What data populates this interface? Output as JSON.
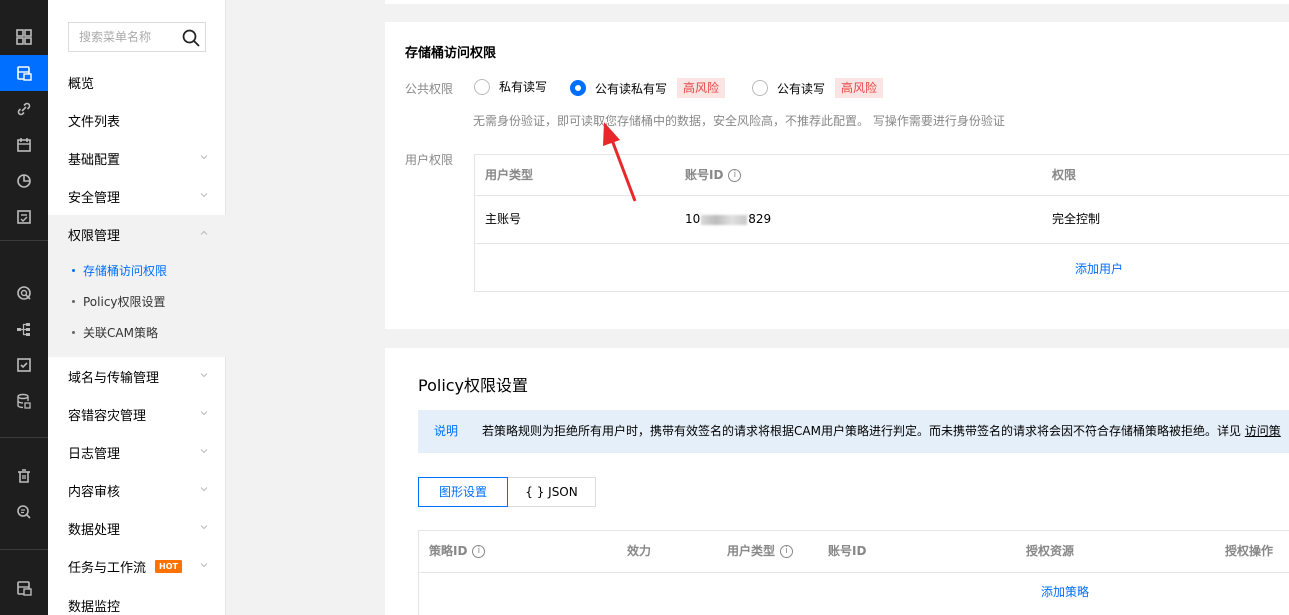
{
  "rail": {
    "icons": [
      "grid-icon",
      "bucket-icon",
      "link-icon",
      "calendar-icon",
      "pie-chart-icon",
      "checklist-icon",
      "monitor-icon",
      "hierarchy-icon",
      "checkbox-icon",
      "database-icon",
      "trash-icon",
      "search-doc-icon",
      "storage-icon"
    ]
  },
  "sidebar": {
    "search_placeholder": "搜索菜单名称",
    "items": [
      {
        "label": "概览"
      },
      {
        "label": "文件列表"
      },
      {
        "label": "基础配置"
      },
      {
        "label": "安全管理"
      },
      {
        "label": "权限管理"
      },
      {
        "label": "域名与传输管理"
      },
      {
        "label": "容错容灾管理"
      },
      {
        "label": "日志管理"
      },
      {
        "label": "内容审核"
      },
      {
        "label": "数据处理"
      },
      {
        "label": "任务与工作流"
      },
      {
        "label": "数据监控"
      }
    ],
    "sub_items": [
      {
        "label": "存储桶访问权限"
      },
      {
        "label": "Policy权限设置"
      },
      {
        "label": "关联CAM策略"
      }
    ],
    "hot_badge": "HOT"
  },
  "bucket_acl": {
    "title": "存储桶访问权限",
    "public_label": "公共权限",
    "options": [
      {
        "label": "私有读写"
      },
      {
        "label": "公有读私有写"
      },
      {
        "label": "公有读写"
      }
    ],
    "risk_label": "高风险",
    "hint": "无需身份验证，即可读取您存储桶中的数据，安全风险高，不推荐此配置。 写操作需要进行身份验证",
    "user_label": "用户权限",
    "table": {
      "headers": [
        "用户类型",
        "账号ID",
        "权限"
      ],
      "row": {
        "type": "主账号",
        "id_prefix": "10",
        "id_suffix": "829",
        "perm": "完全控制"
      },
      "add_user": "添加用户"
    }
  },
  "policy": {
    "title": "Policy权限设置",
    "notice_tag": "说明",
    "notice_text": "若策略规则为拒绝所有用户时，携带有效签名的请求将根据CAM用户策略进行判定。而未携带签名的请求将会因不符合存储桶策略被拒绝。详见",
    "notice_link": "访问策",
    "tabs": [
      "图形设置",
      "{ } JSON"
    ],
    "table": {
      "headers": [
        "策略ID",
        "效力",
        "用户类型",
        "账号ID",
        "授权资源",
        "授权操作"
      ],
      "add_policy": "添加策略"
    }
  },
  "colors": {
    "accent": "#006eff",
    "risk": "#e54545",
    "risk_bg": "#fbe4e4",
    "annotation_arrow": "#e8282b"
  }
}
